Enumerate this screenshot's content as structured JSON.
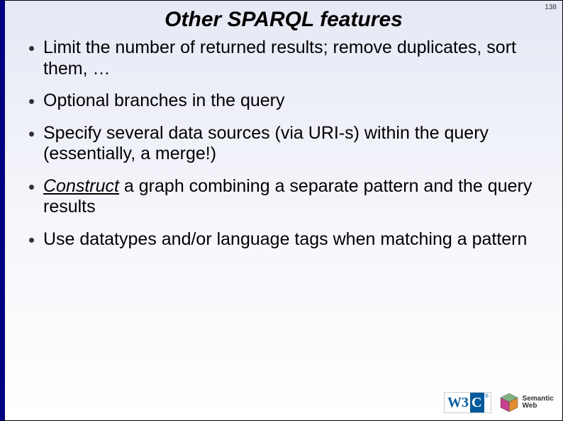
{
  "page_number": "138",
  "title": "Other SPARQL features",
  "bullets": [
    {
      "text_before": "Limit the number of returned results; remove duplicates, sort them, …",
      "emph": "",
      "text_after": ""
    },
    {
      "text_before": "Optional branches in the query",
      "emph": "",
      "text_after": ""
    },
    {
      "text_before": "Specify several data sources (via URI-s) within the query (essentially, a merge!)",
      "emph": "",
      "text_after": ""
    },
    {
      "text_before": "",
      "emph": "Construct",
      "text_after": " a graph combining a separate pattern and the query results"
    },
    {
      "text_before": "Use datatypes and/or language tags when matching a pattern",
      "emph": "",
      "text_after": ""
    }
  ],
  "logos": {
    "w3c_w3": "W3",
    "w3c_c": "C",
    "w3c_r": "®",
    "sw_line1": "Semantic",
    "sw_line2": "Web"
  }
}
